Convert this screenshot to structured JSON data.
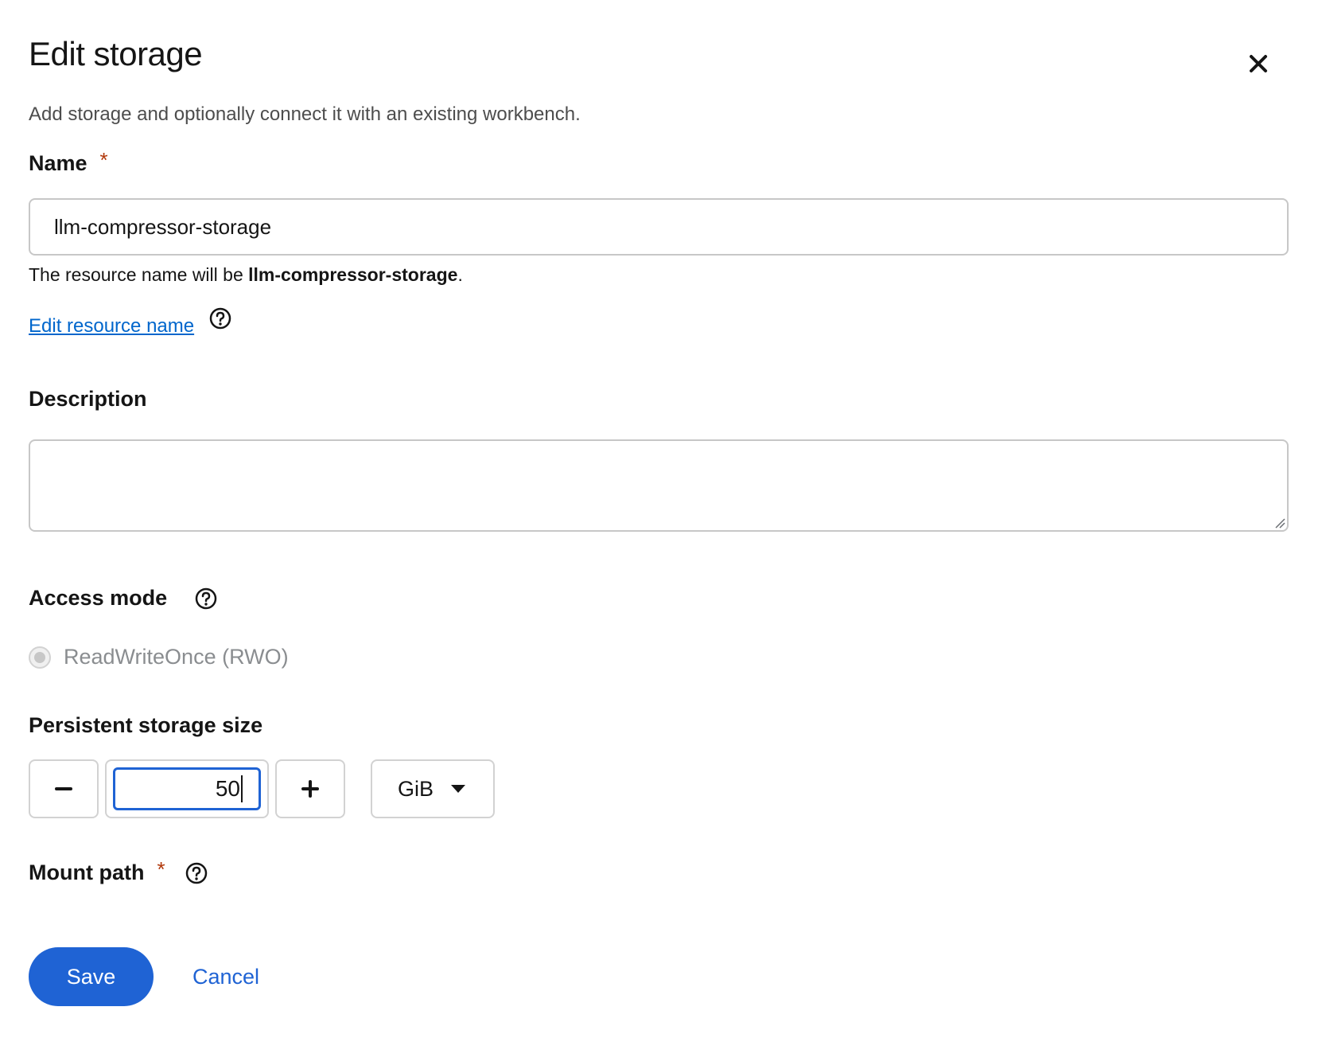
{
  "modal": {
    "title": "Edit storage",
    "subtitle": "Add storage and optionally connect it with an existing workbench."
  },
  "name_field": {
    "label": "Name",
    "required_marker": "*",
    "value": "llm-compressor-storage",
    "helper_prefix": "The resource name will be ",
    "helper_value": "llm-compressor-storage",
    "helper_suffix": ".",
    "edit_link": "Edit resource name"
  },
  "description_field": {
    "label": "Description",
    "value": ""
  },
  "access_mode": {
    "label": "Access mode",
    "option_label": "ReadWriteOnce (RWO)",
    "selected": true,
    "disabled": true
  },
  "storage_size": {
    "label": "Persistent storage size",
    "value": "50",
    "unit": "GiB"
  },
  "mount_path": {
    "label": "Mount path",
    "required_marker": "*"
  },
  "footer": {
    "save_label": "Save",
    "cancel_label": "Cancel"
  },
  "colors": {
    "primary": "#1f63d4",
    "link": "#0066cc",
    "required": "#b1380b"
  }
}
